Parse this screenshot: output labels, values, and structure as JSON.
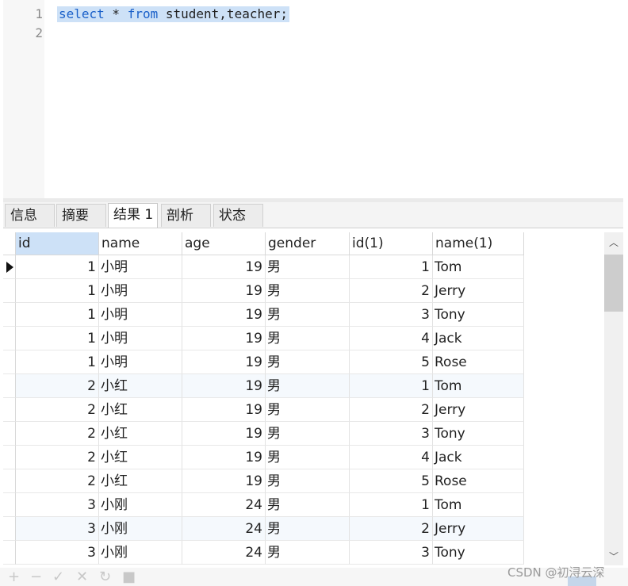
{
  "editor": {
    "line_numbers": [
      "1",
      "2"
    ],
    "query_parts": {
      "kw_select": "select",
      "star": " * ",
      "kw_from": "from",
      "rest": " student,teacher;"
    }
  },
  "tabs": [
    {
      "label": "信息"
    },
    {
      "label": "摘要"
    },
    {
      "label": "结果 1",
      "active": true
    },
    {
      "label": "剖析"
    },
    {
      "label": "状态"
    }
  ],
  "grid": {
    "columns": [
      "id",
      "name",
      "age",
      "gender",
      "id(1)",
      "name(1)"
    ],
    "rows": [
      [
        "1",
        "小明",
        "19",
        "男",
        "1",
        "Tom"
      ],
      [
        "1",
        "小明",
        "19",
        "男",
        "2",
        "Jerry"
      ],
      [
        "1",
        "小明",
        "19",
        "男",
        "3",
        "Tony"
      ],
      [
        "1",
        "小明",
        "19",
        "男",
        "4",
        "Jack"
      ],
      [
        "1",
        "小明",
        "19",
        "男",
        "5",
        "Rose"
      ],
      [
        "2",
        "小红",
        "19",
        "男",
        "1",
        "Tom"
      ],
      [
        "2",
        "小红",
        "19",
        "男",
        "2",
        "Jerry"
      ],
      [
        "2",
        "小红",
        "19",
        "男",
        "3",
        "Tony"
      ],
      [
        "2",
        "小红",
        "19",
        "男",
        "4",
        "Jack"
      ],
      [
        "2",
        "小红",
        "19",
        "男",
        "5",
        "Rose"
      ],
      [
        "3",
        "小刚",
        "24",
        "男",
        "1",
        "Tom"
      ],
      [
        "3",
        "小刚",
        "24",
        "男",
        "2",
        "Jerry"
      ],
      [
        "3",
        "小刚",
        "24",
        "男",
        "3",
        "Tony"
      ]
    ]
  },
  "toolbar": {
    "icons": [
      "add-icon",
      "remove-icon",
      "apply-icon",
      "cancel-icon",
      "refresh-icon",
      "stop-icon"
    ],
    "glyphs": [
      "+",
      "−",
      "✓",
      "✕",
      "↻",
      "■"
    ]
  },
  "watermark": "CSDN @初浔云深"
}
